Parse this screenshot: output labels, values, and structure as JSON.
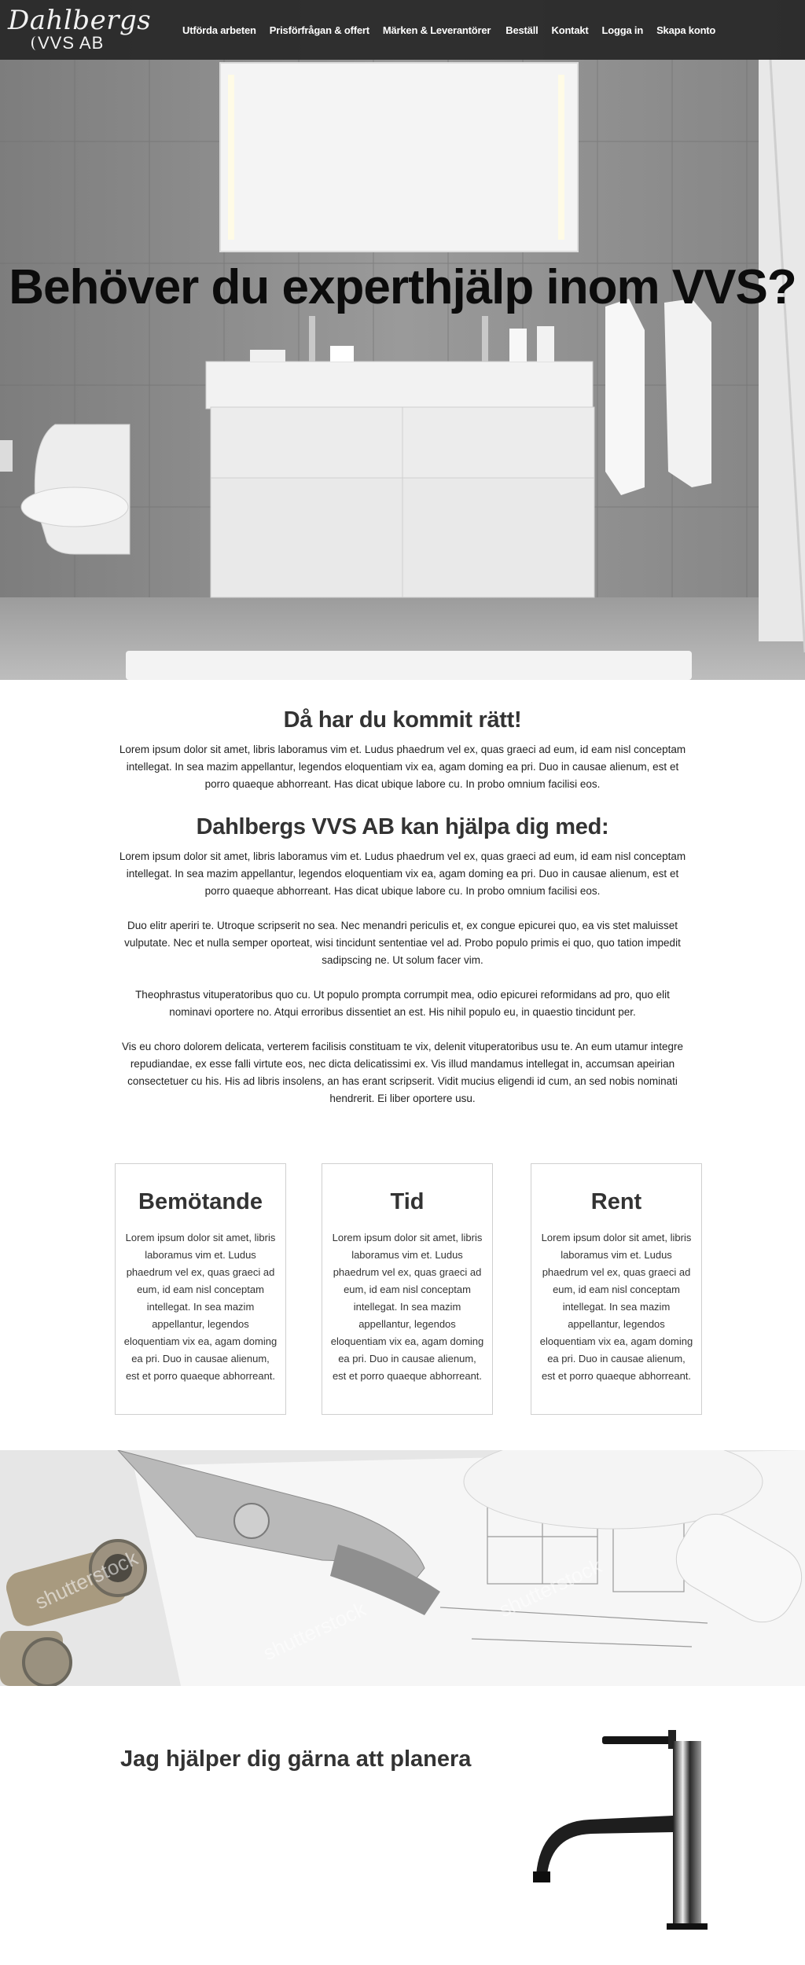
{
  "brand": {
    "logo_script": "Dahlbergs",
    "logo_sub": "VVS AB"
  },
  "nav": [
    {
      "label": "Utförda arbeten"
    },
    {
      "label": "Prisförfrågan & offert"
    },
    {
      "label": "Märken & Leverantörer"
    },
    {
      "label": "Beställ"
    },
    {
      "label": "Kontakt"
    },
    {
      "label": "Logga in"
    },
    {
      "label": "Skapa konto"
    }
  ],
  "hero": {
    "title": "Behöver du experthjälp inom VVS?"
  },
  "intro": {
    "heading": "Då har du kommit rätt!",
    "text": "Lorem ipsum dolor sit amet, libris laboramus vim et. Ludus phaedrum vel ex, quas graeci ad eum, id eam nisl conceptam intellegat. In sea mazim appellantur, legendos eloquentiam vix ea, agam doming ea pri. Duo in causae alienum, est et porro quaeque abhorreant. Has dicat ubique labore cu. In probo omnium facilisi eos."
  },
  "help": {
    "heading": "Dahlbergs VVS AB kan hjälpa dig med:",
    "paragraphs": [
      "Lorem ipsum dolor sit amet, libris laboramus vim et. Ludus phaedrum vel ex, quas graeci ad eum, id eam nisl conceptam intellegat. In sea mazim appellantur, legendos eloquentiam vix ea, agam doming ea pri. Duo in causae alienum, est et porro quaeque abhorreant. Has dicat ubique labore cu. In probo omnium facilisi eos.",
      "Duo elitr aperiri te. Utroque scripserit no sea. Nec menandri periculis et, ex congue epicurei quo, ea vis stet maluisset vulputate. Nec et nulla semper oporteat, wisi tincidunt sententiae vel ad. Probo populo primis ei quo, quo tation impedit sadipscing ne. Ut solum facer vim.",
      "Theophrastus vituperatoribus quo cu. Ut populo prompta corrumpit mea, odio epicurei reformidans ad pro, quo elit nominavi oportere no. Atqui erroribus dissentiet an est. His nihil populo eu, in quaestio tincidunt per.",
      "Vis eu choro dolorem delicata, verterem facilisis constituam te vix, delenit vituperatoribus usu te. An eum utamur integre repudiandae, ex esse falli virtute eos, nec dicta delicatissimi ex. Vis illud mandamus intellegat in, accumsan apeirian consectetuer cu his. His ad libris insolens, an has erant scripserit. Vidit mucius eligendi id cum, an sed nobis nominati hendrerit. Ei liber oportere usu."
    ]
  },
  "cards": [
    {
      "title": "Bemötande",
      "text": "Lorem ipsum dolor sit amet, libris laboramus vim et. Ludus phaedrum vel ex, quas graeci ad eum, id eam nisl conceptam intellegat. In sea mazim appellantur, legendos eloquentiam vix ea, agam doming ea pri. Duo in causae alienum, est et porro quaeque abhorreant."
    },
    {
      "title": "Tid",
      "text": "Lorem ipsum dolor sit amet, libris laboramus vim et. Ludus phaedrum vel ex, quas graeci ad eum, id eam nisl conceptam intellegat. In sea mazim appellantur, legendos eloquentiam vix ea, agam doming ea pri. Duo in causae alienum, est et porro quaeque abhorreant."
    },
    {
      "title": "Rent",
      "text": "Lorem ipsum dolor sit amet, libris laboramus vim et. Ludus phaedrum vel ex, quas graeci ad eum, id eam nisl conceptam intellegat. In sea mazim appellantur, legendos eloquentiam vix ea, agam doming ea pri. Duo in causae alienum, est et porro quaeque abhorreant."
    }
  ],
  "tools_image": {
    "watermark": "shutterstock"
  },
  "planning": {
    "heading": "Jag hjälper dig gärna att planera"
  },
  "colors": {
    "header_bg": "#262626",
    "text_dark": "#333333",
    "card_border": "#cfcfcf"
  }
}
